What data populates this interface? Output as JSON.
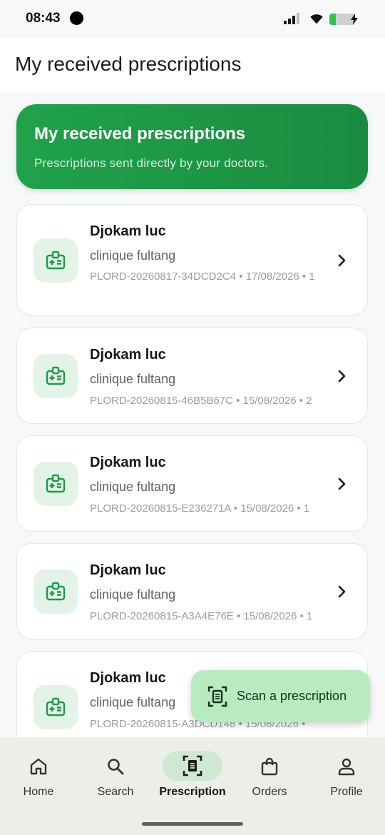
{
  "status_bar": {
    "time": "08:43"
  },
  "header": {
    "title": "My received prescriptions"
  },
  "banner": {
    "title": "My received prescriptions",
    "subtitle": "Prescriptions sent directly by your doctors."
  },
  "prescriptions": [
    {
      "doctor": "Djokam luc",
      "clinic": "clinique fultang",
      "meta": "PLORD-20260817-34DCD2C4 • 17/08/2026 • 1"
    },
    {
      "doctor": "Djokam luc",
      "clinic": "clinique fultang",
      "meta": "PLORD-20260815-46B5B67C • 15/08/2026 • 2"
    },
    {
      "doctor": "Djokam luc",
      "clinic": "clinique fultang",
      "meta": "PLORD-20260815-E236271A • 15/08/2026 • 1"
    },
    {
      "doctor": "Djokam luc",
      "clinic": "clinique fultang",
      "meta": "PLORD-20260815-A3A4E76E • 15/08/2026 • 1"
    },
    {
      "doctor": "Djokam luc",
      "clinic": "clinique fultang",
      "meta": "PLORD-20260815-A3DCD148 • 15/08/2026 •"
    }
  ],
  "fab": {
    "label": "Scan a prescription",
    "icon": "scan-document-icon"
  },
  "bottom_nav": {
    "active": "Prescription",
    "items": [
      {
        "label": "Home",
        "icon": "home-icon"
      },
      {
        "label": "Search",
        "icon": "search-icon"
      },
      {
        "label": "Prescription",
        "icon": "prescription-scan-icon"
      },
      {
        "label": "Orders",
        "icon": "shopping-bag-icon"
      },
      {
        "label": "Profile",
        "icon": "person-icon"
      }
    ]
  },
  "colors": {
    "accent": "#1f9a48",
    "icon_bg": "#e3f3e7",
    "fab_bg": "#b8ecbf",
    "nav_bg": "#ecefe9",
    "active_pill": "#cfe8d2"
  }
}
